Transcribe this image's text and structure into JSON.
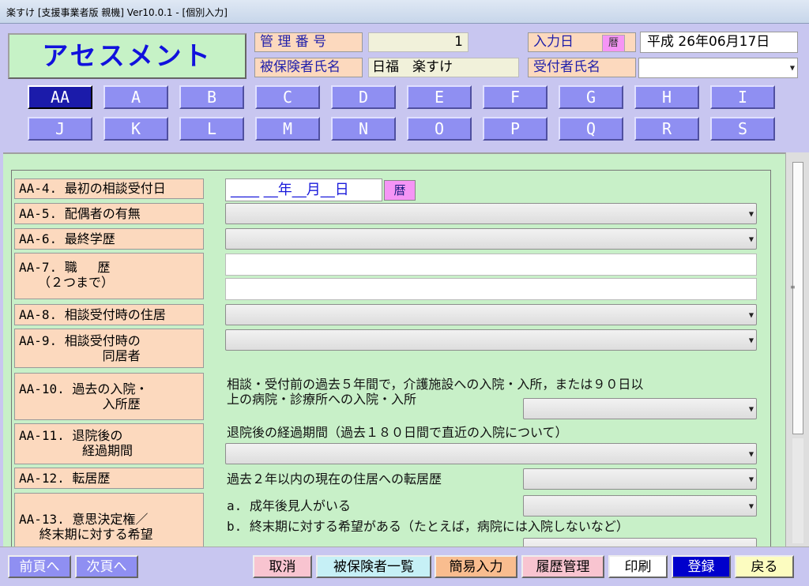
{
  "window": {
    "title": "楽すけ [支援事業者版 親機] Ver10.0.1 - [個別入力]"
  },
  "header": {
    "screen_title": "アセスメント",
    "management_no_label": "管 理 番 号",
    "management_no_value": "1",
    "insured_name_label": "被保険者氏名",
    "insured_name_value": "日福　楽すけ",
    "input_date_label": "入力日",
    "calendar_button": "暦",
    "input_date_value": "平成 26年06月17日",
    "receptionist_label": "受付者氏名",
    "receptionist_value": ""
  },
  "sections": [
    "AA",
    "A",
    "B",
    "C",
    "D",
    "E",
    "F",
    "G",
    "H",
    "I",
    "J",
    "K",
    "L",
    "M",
    "N",
    "O",
    "P",
    "Q",
    "R",
    "S"
  ],
  "active_section": "AA",
  "items": {
    "aa4": "AA-4. 最初の相談受付日",
    "aa5": "AA-5. 配偶者の有無",
    "aa6": "AA-6. 最終学歴",
    "aa7": "AA-7. 職　 歴\n　　（２つまで）",
    "aa8": "AA-8. 相談受付時の住居",
    "aa9": "AA-9. 相談受付時の\n　　　　　　 同居者",
    "aa10": "AA-10. 過去の入院・\n　　　　　　 入所歴",
    "aa11": "AA-11. 退院後の\n　　　　　経過期間",
    "aa12": "AA-12. 転居歴",
    "aa13": "AA-13. 意思決定権／\n　 終末期に対する希望"
  },
  "date_input": {
    "value": "____ __年__月__日",
    "calendar_button": "暦"
  },
  "notes": {
    "aa10_line1": "相談・受付前の過去５年間で，介護施設への入院・入所，または９０日以",
    "aa10_line2": "上の病院・診療所への入院・入所",
    "aa11": "退院後の経過期間（過去１８０日間で直近の入院について）",
    "aa12": "過去２年以内の現在の住居への転居歴",
    "aa13_a": "a. 成年後見人がいる",
    "aa13_b": "b. 終末期に対する希望がある（たとえば，病院には入院しないなど）"
  },
  "footer": {
    "prev_page": "前頁へ",
    "next_page": "次頁へ",
    "cancel": "取消",
    "insured_list": "被保険者一覧",
    "quick_input": "簡易入力",
    "history": "履歴管理",
    "print": "印刷",
    "register": "登録",
    "back": "戻る"
  },
  "colors": {
    "background": "#c8c6f0",
    "content": "#c8f0c8",
    "label": "#fcd9be",
    "section_button": "#8f8ff2",
    "section_active": "#1b1baa",
    "register_button": "#0000cc"
  }
}
